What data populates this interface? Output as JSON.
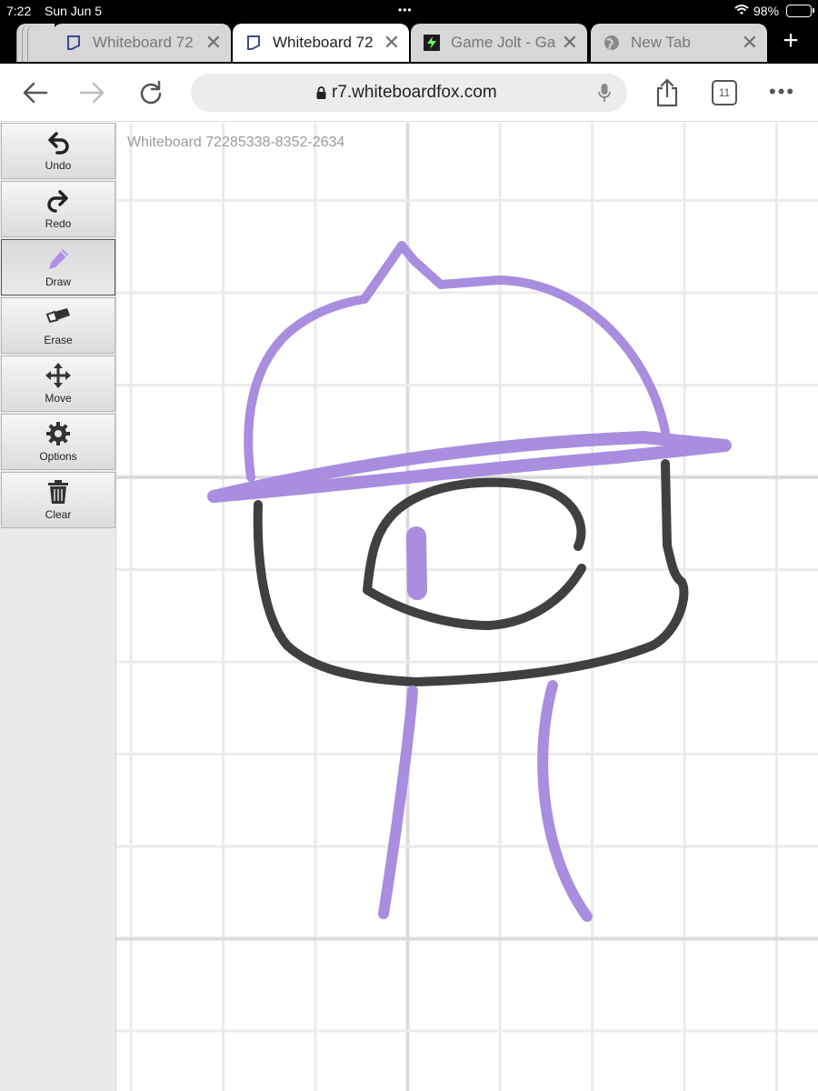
{
  "status_bar": {
    "time": "7:22",
    "date": "Sun Jun 5",
    "battery": "98%"
  },
  "tabs": [
    {
      "title": "Whiteboard 72",
      "active": false,
      "icon": "whiteboard-favicon"
    },
    {
      "title": "Whiteboard 72",
      "active": true,
      "icon": "whiteboard-favicon"
    },
    {
      "title": "Game Jolt - Ga",
      "active": false,
      "icon": "gamejolt-favicon"
    },
    {
      "title": "New Tab",
      "active": false,
      "icon": "globe-icon"
    }
  ],
  "toolbar": {
    "url": "r7.whiteboardfox.com",
    "tabs_count": "11"
  },
  "board": {
    "id_label": "Whiteboard 72285338-8352-2634"
  },
  "tools": [
    {
      "label": "Undo",
      "icon": "undo-icon"
    },
    {
      "label": "Redo",
      "icon": "redo-icon"
    },
    {
      "label": "Draw",
      "icon": "pencil-icon",
      "active": true
    },
    {
      "label": "Erase",
      "icon": "eraser-icon"
    },
    {
      "label": "Move",
      "icon": "move-icon"
    },
    {
      "label": "Options",
      "icon": "gear-icon"
    },
    {
      "label": "Clear",
      "icon": "trash-icon"
    }
  ],
  "colors": {
    "purple_stroke": "#a98ddf",
    "dark_stroke": "#404040",
    "grid": "#ebebeb",
    "grid_major": "#dcdcdc"
  }
}
